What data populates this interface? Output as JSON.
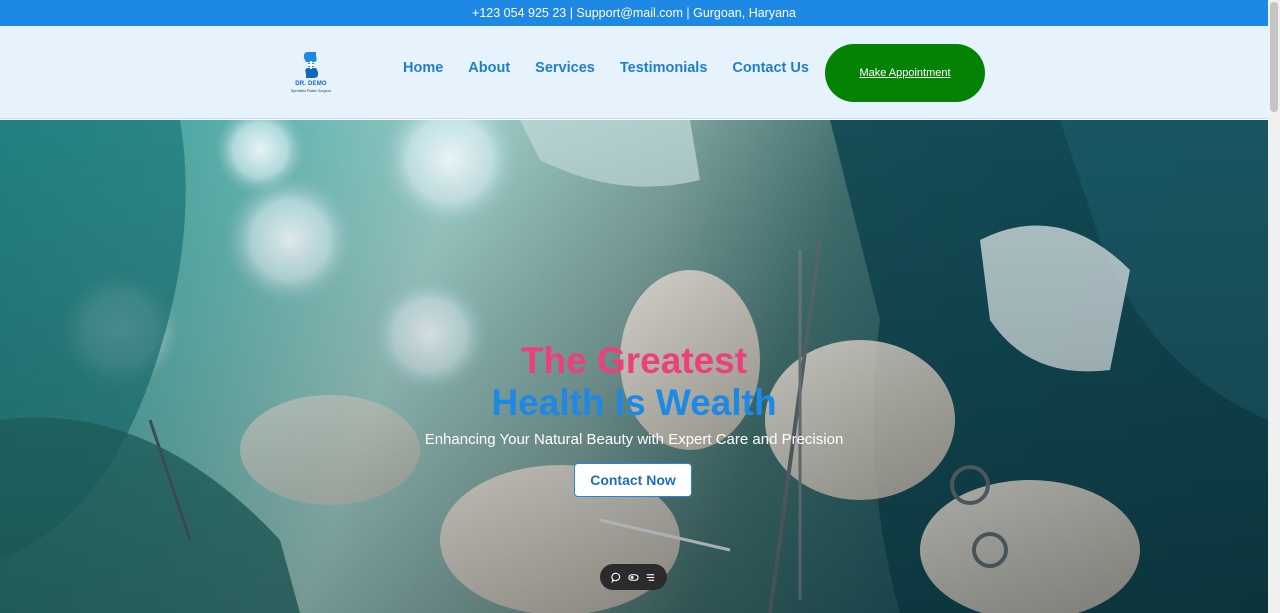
{
  "topbar": {
    "contact_line": "+123 054 925 23 | Support@mail.com | Gurgoan, Haryana"
  },
  "logo": {
    "brand": "DR. DEMO",
    "tagline": "Specialist Plastic Surgeon",
    "icon": "medical-s-cross-icon",
    "color": "#1e88e5"
  },
  "nav": {
    "items": [
      {
        "label": "Home"
      },
      {
        "label": "About"
      },
      {
        "label": "Services"
      },
      {
        "label": "Testimonials"
      },
      {
        "label": "Contact Us"
      }
    ],
    "cta_label": "Make Appointment"
  },
  "hero": {
    "headline_line1": "The Greatest",
    "headline_line2": "Health Is Wealth",
    "subtitle": "Enhancing Your Natural Beauty with Expert Care and Precision",
    "cta_label": "Contact Now",
    "background": "surgery-team-photo",
    "float_icons": [
      "chat-icon",
      "toggle-icon",
      "menu-icon"
    ]
  },
  "colors": {
    "topbar": "#1e88e5",
    "header_bg": "#e6f3fd",
    "nav_text": "#1e7fc8",
    "cta_green": "#038203",
    "headline_pink": "#ec407a",
    "headline_blue": "#1e88e5"
  }
}
